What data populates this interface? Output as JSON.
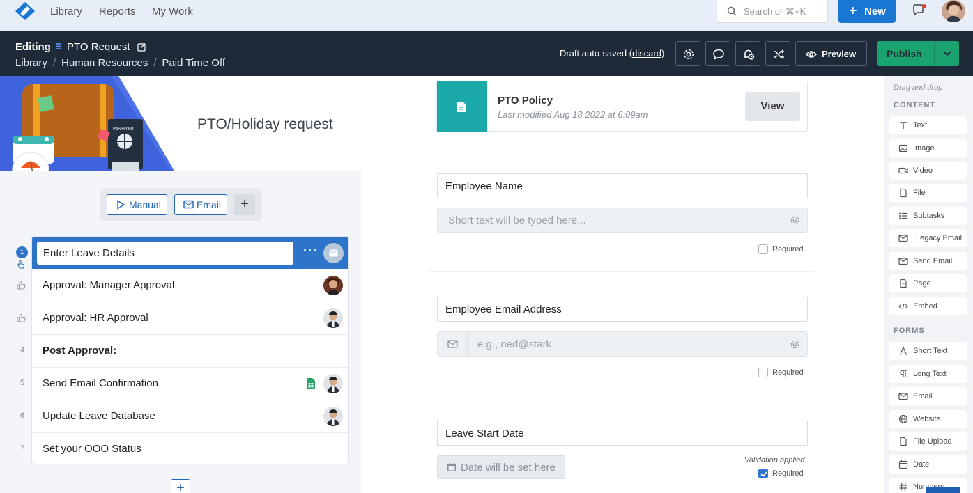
{
  "nav": {
    "links": [
      "Library",
      "Reports",
      "My Work"
    ],
    "search_placeholder": "Search or ⌘+K",
    "new_label": "New"
  },
  "header": {
    "editing_label": "Editing",
    "workflow_title": "PTO Request",
    "breadcrumbs": [
      "Library",
      "Human Resources",
      "Paid Time Off"
    ],
    "draft_text": "Draft auto-saved",
    "discard_label": "discard",
    "preview_label": "Preview",
    "publish_label": "Publish"
  },
  "left": {
    "hero_title": "PTO/Holiday request",
    "passport_text": "PASSPORT",
    "manual_label": "Manual",
    "email_label": "Email",
    "tasks": [
      {
        "num": "1",
        "name": "Enter Leave Details"
      },
      {
        "num": "",
        "name": "Approval: Manager Approval"
      },
      {
        "num": "",
        "name": "Approval: HR Approval"
      },
      {
        "num": "4",
        "name": "Post Approval:"
      },
      {
        "num": "5",
        "name": "Send Email Confirmation"
      },
      {
        "num": "6",
        "name": "Update Leave Database"
      },
      {
        "num": "7",
        "name": "Set your OOO Status"
      }
    ]
  },
  "form": {
    "file_title": "PTO Policy",
    "file_meta": "Last modified Aug 18 2022 at 6:09am",
    "view_label": "View",
    "fields": [
      {
        "label": "Employee Name",
        "placeholder": "Short text will be typed here...",
        "required_label": "Required"
      },
      {
        "label": "Employee Email Address",
        "placeholder": "e.g., ned@stark",
        "required_label": "Required"
      },
      {
        "label": "Leave Start Date",
        "placeholder": "Date will be set here",
        "required_label": "Required",
        "validation": "Validation applied"
      }
    ]
  },
  "sidebar": {
    "hint": "Drag and drop",
    "content_heading": "CONTENT",
    "content_items": [
      "Text",
      "Image",
      "Video",
      "File",
      "Subtasks",
      "Legacy Email",
      "Send Email",
      "Page",
      "Embed"
    ],
    "forms_heading": "FORMS",
    "form_items": [
      "Short Text",
      "Long Text",
      "Email",
      "Website",
      "File Upload",
      "Date",
      "Numbers"
    ]
  },
  "colors": {
    "primary": "#1976d2",
    "dark_header": "#1e2a38",
    "publish": "#1aa36f",
    "active_task": "#2e74c9",
    "file_tile": "#1aa8a8"
  }
}
